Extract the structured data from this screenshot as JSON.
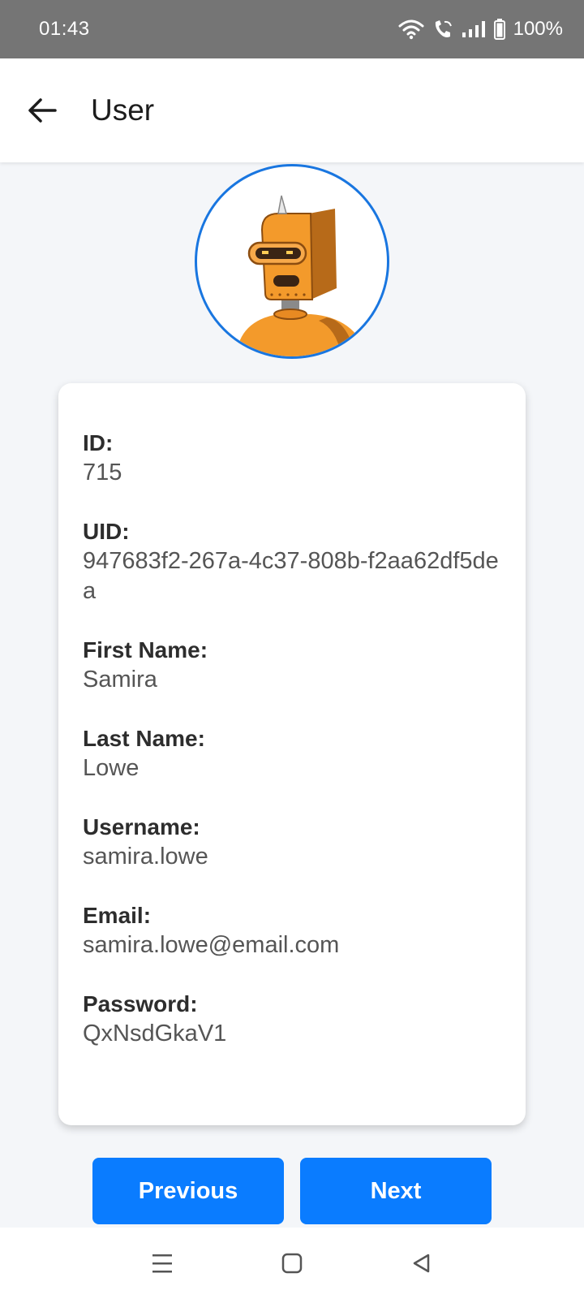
{
  "status_bar": {
    "time": "01:43",
    "battery": "100%",
    "icons": [
      "wifi-icon",
      "wifi-call-icon",
      "signal-icon",
      "battery-icon"
    ]
  },
  "app_bar": {
    "title": "User",
    "back_icon": "arrow-left-icon"
  },
  "avatar": {
    "icon": "robot-avatar",
    "border_color": "#1976e0"
  },
  "user": {
    "fields": [
      {
        "label": "ID:",
        "value": "715"
      },
      {
        "label": "UID:",
        "value": "947683f2-267a-4c37-808b-f2aa62df5dea"
      },
      {
        "label": "First Name:",
        "value": "Samira"
      },
      {
        "label": "Last Name:",
        "value": "Lowe"
      },
      {
        "label": "Username:",
        "value": "samira.lowe"
      },
      {
        "label": "Email:",
        "value": "samira.lowe@email.com"
      },
      {
        "label": "Password:",
        "value": "QxNsdGkaV1"
      }
    ]
  },
  "buttons": {
    "previous": "Previous",
    "next": "Next",
    "color": "#0a7cff"
  },
  "nav_bar": {
    "icons": [
      "recent-apps-icon",
      "home-icon",
      "back-triangle-icon"
    ]
  }
}
